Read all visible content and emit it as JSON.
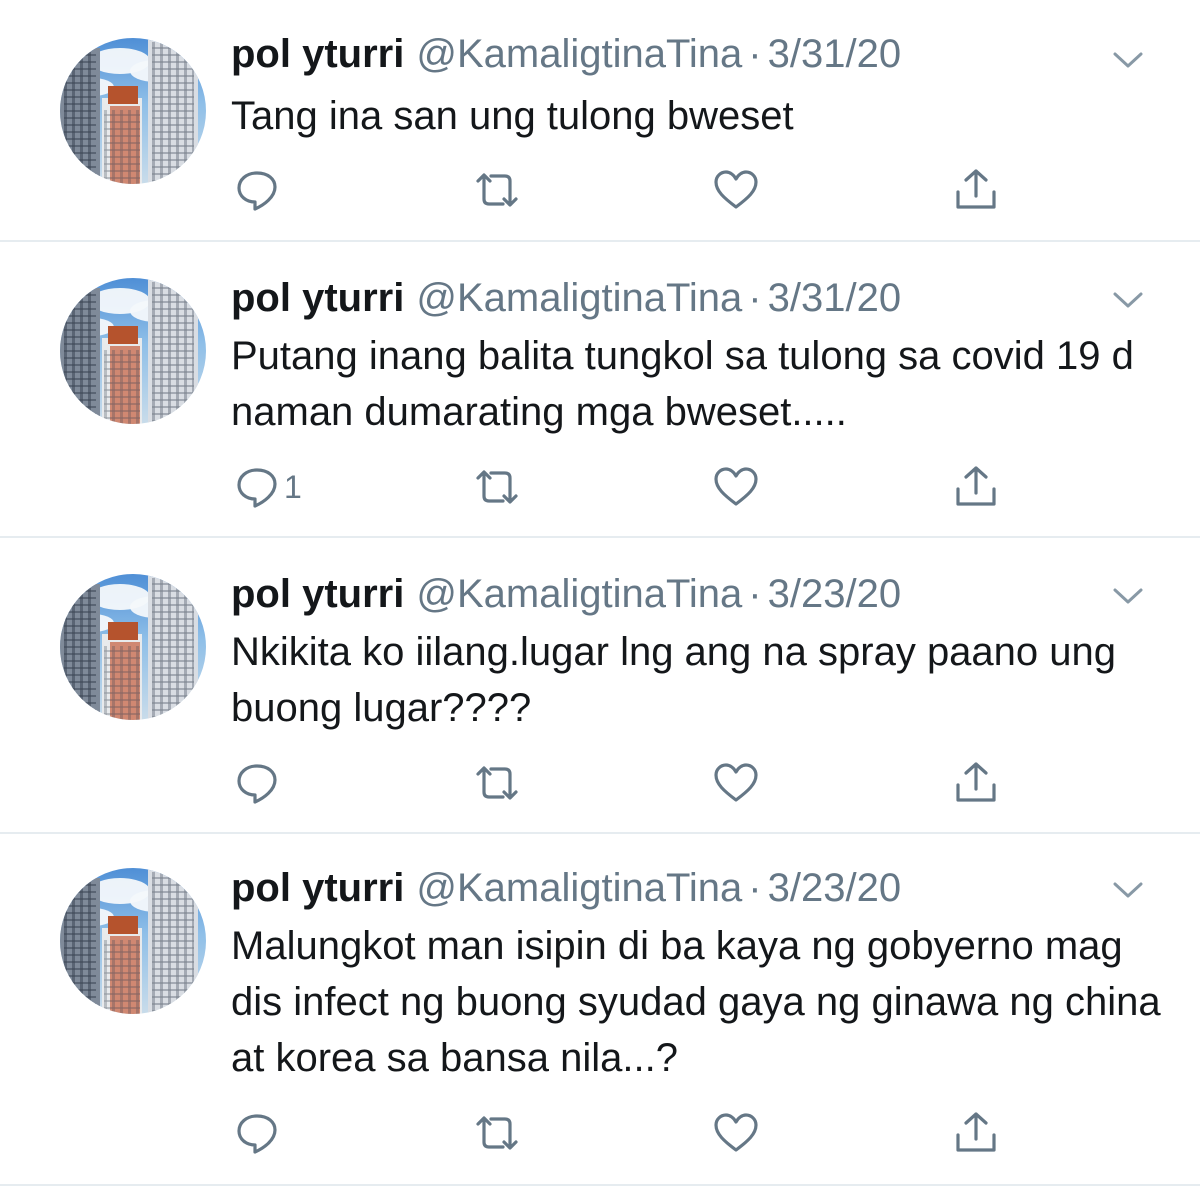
{
  "tweets": [
    {
      "name": "pol yturri",
      "handle": "@KamaligtinaTina",
      "separator": "·",
      "date": "3/31/20",
      "text": "Tang ina san ung tulong bweset",
      "reply_count": ""
    },
    {
      "name": "pol yturri",
      "handle": "@KamaligtinaTina",
      "separator": "·",
      "date": "3/31/20",
      "text": "Putang inang balita tungkol sa tulong sa covid 19 d naman dumarating mga bweset.....",
      "reply_count": "1"
    },
    {
      "name": "pol yturri",
      "handle": "@KamaligtinaTina",
      "separator": "·",
      "date": "3/23/20",
      "text": "Nkikita ko iilang.lugar lng ang na spray paano ung buong lugar????",
      "reply_count": ""
    },
    {
      "name": "pol yturri",
      "handle": "@KamaligtinaTina",
      "separator": "·",
      "date": "3/23/20",
      "text": "Malungkot man isipin di ba kaya ng gobyerno mag dis infect ng buong syudad gaya ng ginawa ng china at korea sa bansa nila...?",
      "reply_count": ""
    }
  ],
  "icons": {
    "reply": "reply-icon",
    "retweet": "retweet-icon",
    "like": "like-icon",
    "share": "share-icon",
    "more": "chevron-down-icon"
  },
  "colors": {
    "text": "#14171a",
    "secondary": "#657786",
    "divider": "#e6ecf0"
  }
}
